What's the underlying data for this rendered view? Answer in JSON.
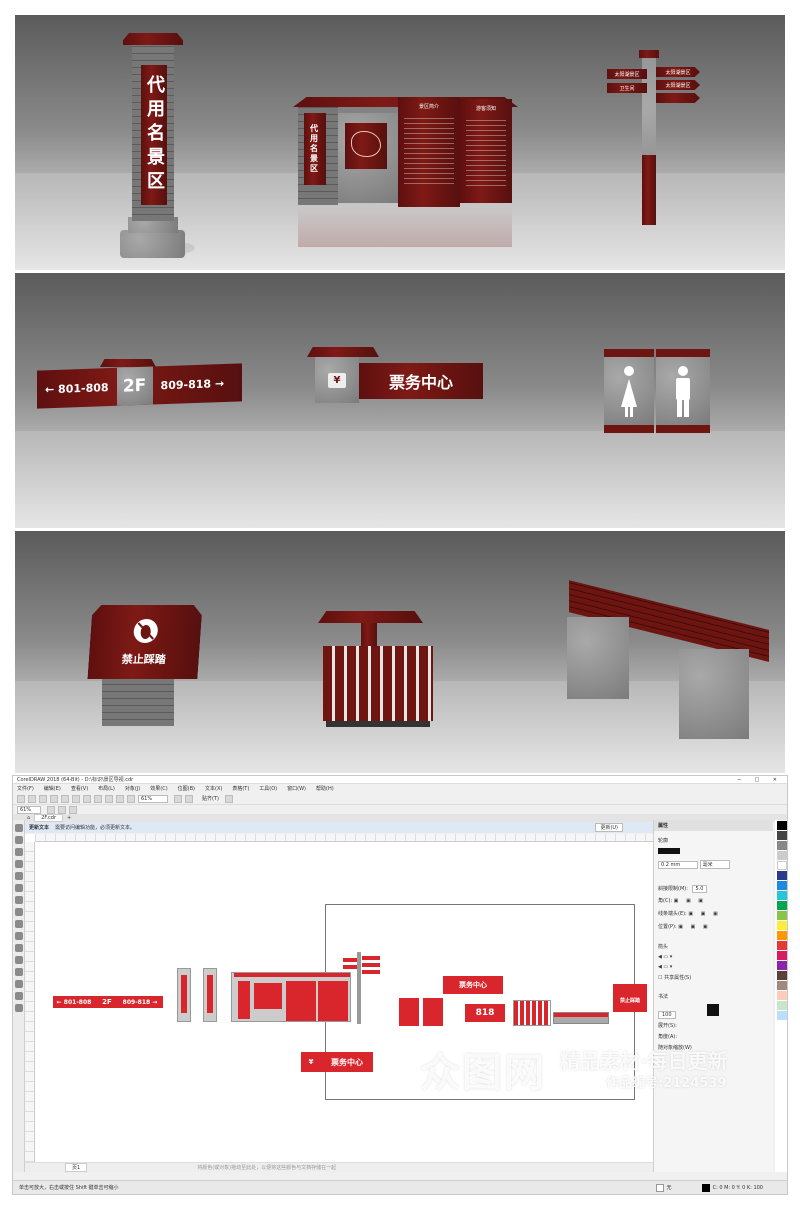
{
  "renders": {
    "pillar_text": "代用名景区",
    "board_vertical_text": "代用名景区",
    "board_heading_1": "景区简介",
    "board_heading_2": "游客须知",
    "direction_1": "太阳湖景区",
    "direction_2": "太阳湖景区",
    "direction_3": "卫生间",
    "direction_4": "太阳湖景区",
    "floor_left": "← 801-808",
    "floor_mid": "2F",
    "floor_right": "809-818 →",
    "ticket_icon": "¥",
    "ticket_text": "票务中心",
    "nogo_text": "禁止踩踏"
  },
  "corel": {
    "title": "CorelDRAW 2018 (64-Bit) - D:\\标识\\景区导视.cdr",
    "menu": [
      "文件(F)",
      "编辑(E)",
      "查看(V)",
      "布局(L)",
      "对象(J)",
      "效果(C)",
      "位图(B)",
      "文本(X)",
      "表格(T)",
      "工具(O)",
      "窗口(W)",
      "帮助(H)"
    ],
    "zoom": "61%",
    "zoom_left": "61%",
    "snap_label": "贴齐(T)",
    "tab_label": "欢迎屏幕",
    "doc_tab": "2F.cdr",
    "hint_title": "更新文本",
    "hint_text": "需要访问编辑功能，必须更新文本。",
    "hint_button": "更新(U)",
    "props_title": "属性",
    "outline_label": "轮廓",
    "outline_width": "0.2 mm",
    "outline_unit": "毫米",
    "miter": "斜接限制(M):",
    "miter_val": "5.0",
    "corner": "角(C):",
    "cap": "线条端头(E):",
    "position": "位置(P):",
    "arrows": "箭头",
    "share_attr": "共享属性(S)",
    "calligraphy": "书法",
    "stretch": "展开(S):",
    "angle": "角度(A):",
    "scale_with": "随对象缩放(W)",
    "callig_val": "100",
    "page_tab": "页1",
    "status_left": "单击可放大，右击或按住 Shift 键单击可缩小",
    "status_fill": "无",
    "status_cmyk": "C: 0 M: 0 Y: 0 K: 100",
    "footer_hint": "将颜色(或对象)拖动至此处，以便将这些颜色与文档存储在一起",
    "thumb_floor_left": "← 801-808",
    "thumb_floor_mid": "2F",
    "thumb_floor_right": "809-818 →",
    "thumb_ticket": "票务中心",
    "thumb_818": "818",
    "thumb_nogo": "禁止踩踏",
    "thumb_ticket_icon": "¥"
  },
  "watermark": {
    "logo": "众图网",
    "slogan": "精品素材·每日更新",
    "code": "作品编号:2124539"
  },
  "colors": {
    "brand_red": "#d8262c",
    "wood": "#6e1512"
  }
}
